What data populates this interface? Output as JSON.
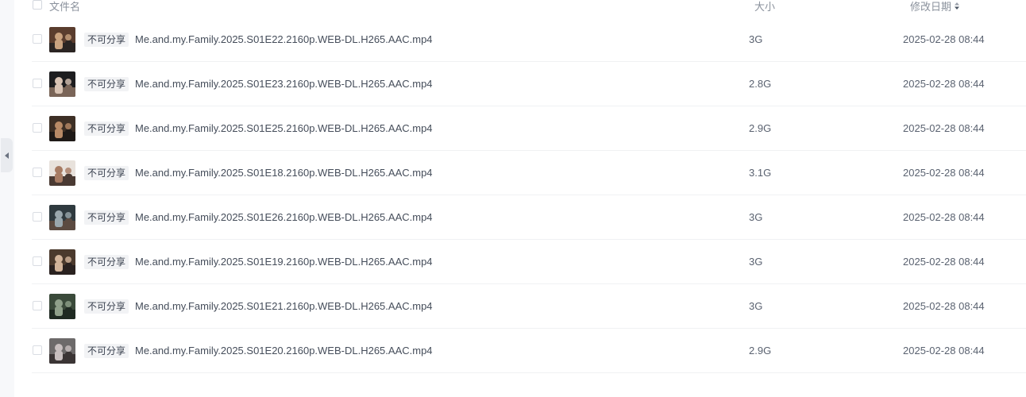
{
  "header": {
    "name_label": "文件名",
    "size_label": "大小",
    "date_label": "修改日期"
  },
  "files": [
    {
      "badge": "不可分享",
      "name": "Me.and.my.Family.2025.S01E22.2160p.WEB-DL.H265.AAC.mp4",
      "size": "3G",
      "date": "2025-02-28 08:44"
    },
    {
      "badge": "不可分享",
      "name": "Me.and.my.Family.2025.S01E23.2160p.WEB-DL.H265.AAC.mp4",
      "size": "2.8G",
      "date": "2025-02-28 08:44"
    },
    {
      "badge": "不可分享",
      "name": "Me.and.my.Family.2025.S01E25.2160p.WEB-DL.H265.AAC.mp4",
      "size": "2.9G",
      "date": "2025-02-28 08:44"
    },
    {
      "badge": "不可分享",
      "name": "Me.and.my.Family.2025.S01E18.2160p.WEB-DL.H265.AAC.mp4",
      "size": "3.1G",
      "date": "2025-02-28 08:44"
    },
    {
      "badge": "不可分享",
      "name": "Me.and.my.Family.2025.S01E26.2160p.WEB-DL.H265.AAC.mp4",
      "size": "3G",
      "date": "2025-02-28 08:44"
    },
    {
      "badge": "不可分享",
      "name": "Me.and.my.Family.2025.S01E19.2160p.WEB-DL.H265.AAC.mp4",
      "size": "3G",
      "date": "2025-02-28 08:44"
    },
    {
      "badge": "不可分享",
      "name": "Me.and.my.Family.2025.S01E21.2160p.WEB-DL.H265.AAC.mp4",
      "size": "3G",
      "date": "2025-02-28 08:44"
    },
    {
      "badge": "不可分享",
      "name": "Me.and.my.Family.2025.S01E20.2160p.WEB-DL.H265.AAC.mp4",
      "size": "2.9G",
      "date": "2025-02-28 08:44"
    }
  ],
  "icons": {
    "collapse": "caret-left-icon",
    "sort": "sort-icon",
    "thumbnail": "video-thumbnail"
  }
}
